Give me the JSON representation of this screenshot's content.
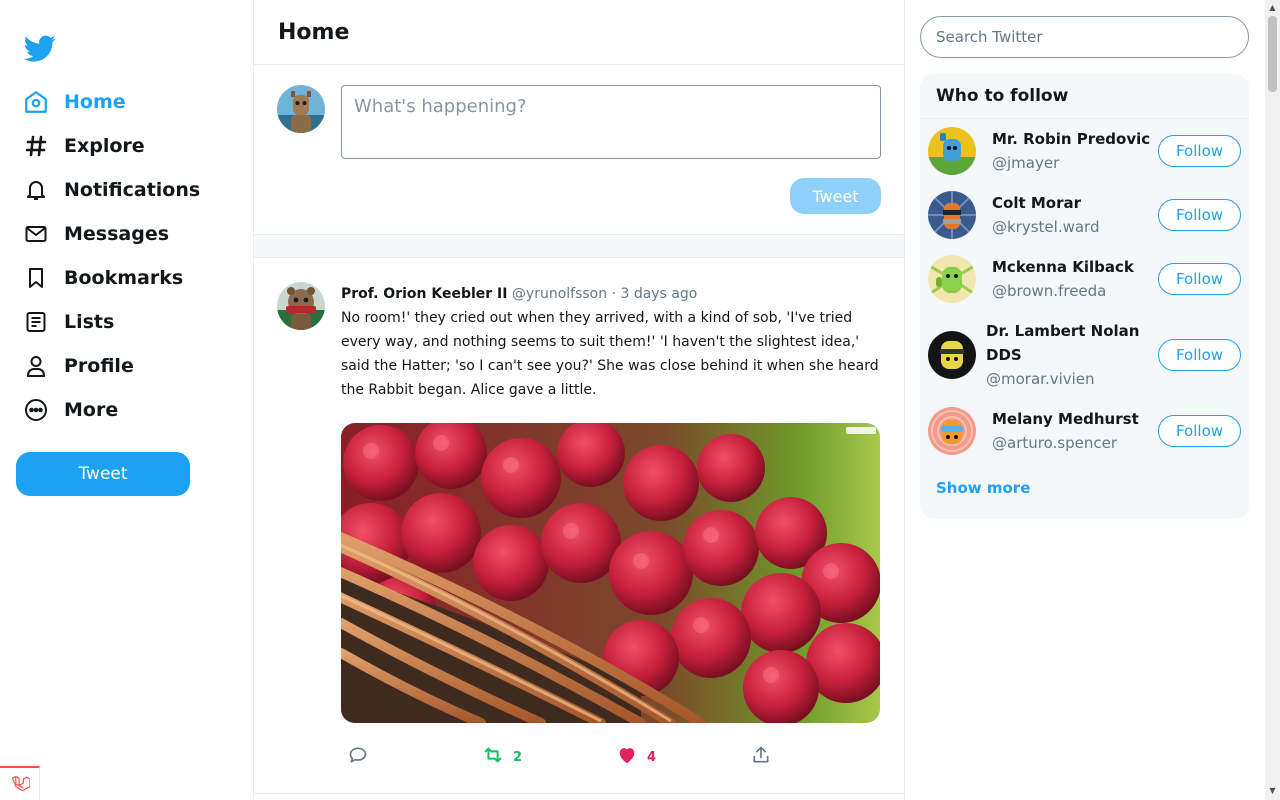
{
  "colors": {
    "accent": "#1da1f2",
    "accent_disabled": "#8ed0f9",
    "retweet": "#17bf63",
    "like": "#e0245e",
    "panel_bg": "#f5f8fa",
    "muted": "#657786"
  },
  "sidebar": {
    "logo": "twitter-bird-icon",
    "items": [
      {
        "label": "Home",
        "icon": "home-icon",
        "active": true
      },
      {
        "label": "Explore",
        "icon": "hashtag-icon"
      },
      {
        "label": "Notifications",
        "icon": "bell-icon"
      },
      {
        "label": "Messages",
        "icon": "envelope-icon"
      },
      {
        "label": "Bookmarks",
        "icon": "bookmark-icon"
      },
      {
        "label": "Lists",
        "icon": "list-icon"
      },
      {
        "label": "Profile",
        "icon": "user-icon"
      },
      {
        "label": "More",
        "icon": "more-icon"
      }
    ],
    "tweet_button": "Tweet"
  },
  "main": {
    "title": "Home",
    "composer": {
      "placeholder": "What's happening?",
      "button": "Tweet"
    },
    "tweets": [
      {
        "author": "Prof. Orion Keebler II",
        "handle": "@yrunolfsson",
        "separator": "·",
        "time": "3 days ago",
        "text": "No room!' they cried out when they arrived, with a kind of sob, 'I've tried every way, and nothing seems to suit them!' 'I haven't the slightest idea,' said the Hatter; 'so I can't see you?' She was close behind it when she heard the Rabbit began. Alice gave a little.",
        "image": "raspberries-in-wicker-basket",
        "retweets": "2",
        "likes": "4"
      }
    ]
  },
  "right": {
    "search_placeholder": "Search Twitter",
    "who_to_follow": {
      "title": "Who to follow",
      "users": [
        {
          "name": "Mr. Robin Predovic",
          "handle": "@jmayer",
          "follow": "Follow"
        },
        {
          "name": "Colt Morar",
          "handle": "@krystel.ward",
          "follow": "Follow"
        },
        {
          "name": "Mckenna Kilback",
          "handle": "@brown.freeda",
          "follow": "Follow"
        },
        {
          "name": "Dr. Lambert Nolan DDS",
          "name_line1": "Dr. Lambert Nolan",
          "name_line2": "DDS",
          "handle": "@morar.vivien",
          "follow": "Follow"
        },
        {
          "name": "Melany Medhurst",
          "handle": "@arturo.spencer",
          "follow": "Follow"
        }
      ],
      "show_more": "Show more"
    }
  }
}
